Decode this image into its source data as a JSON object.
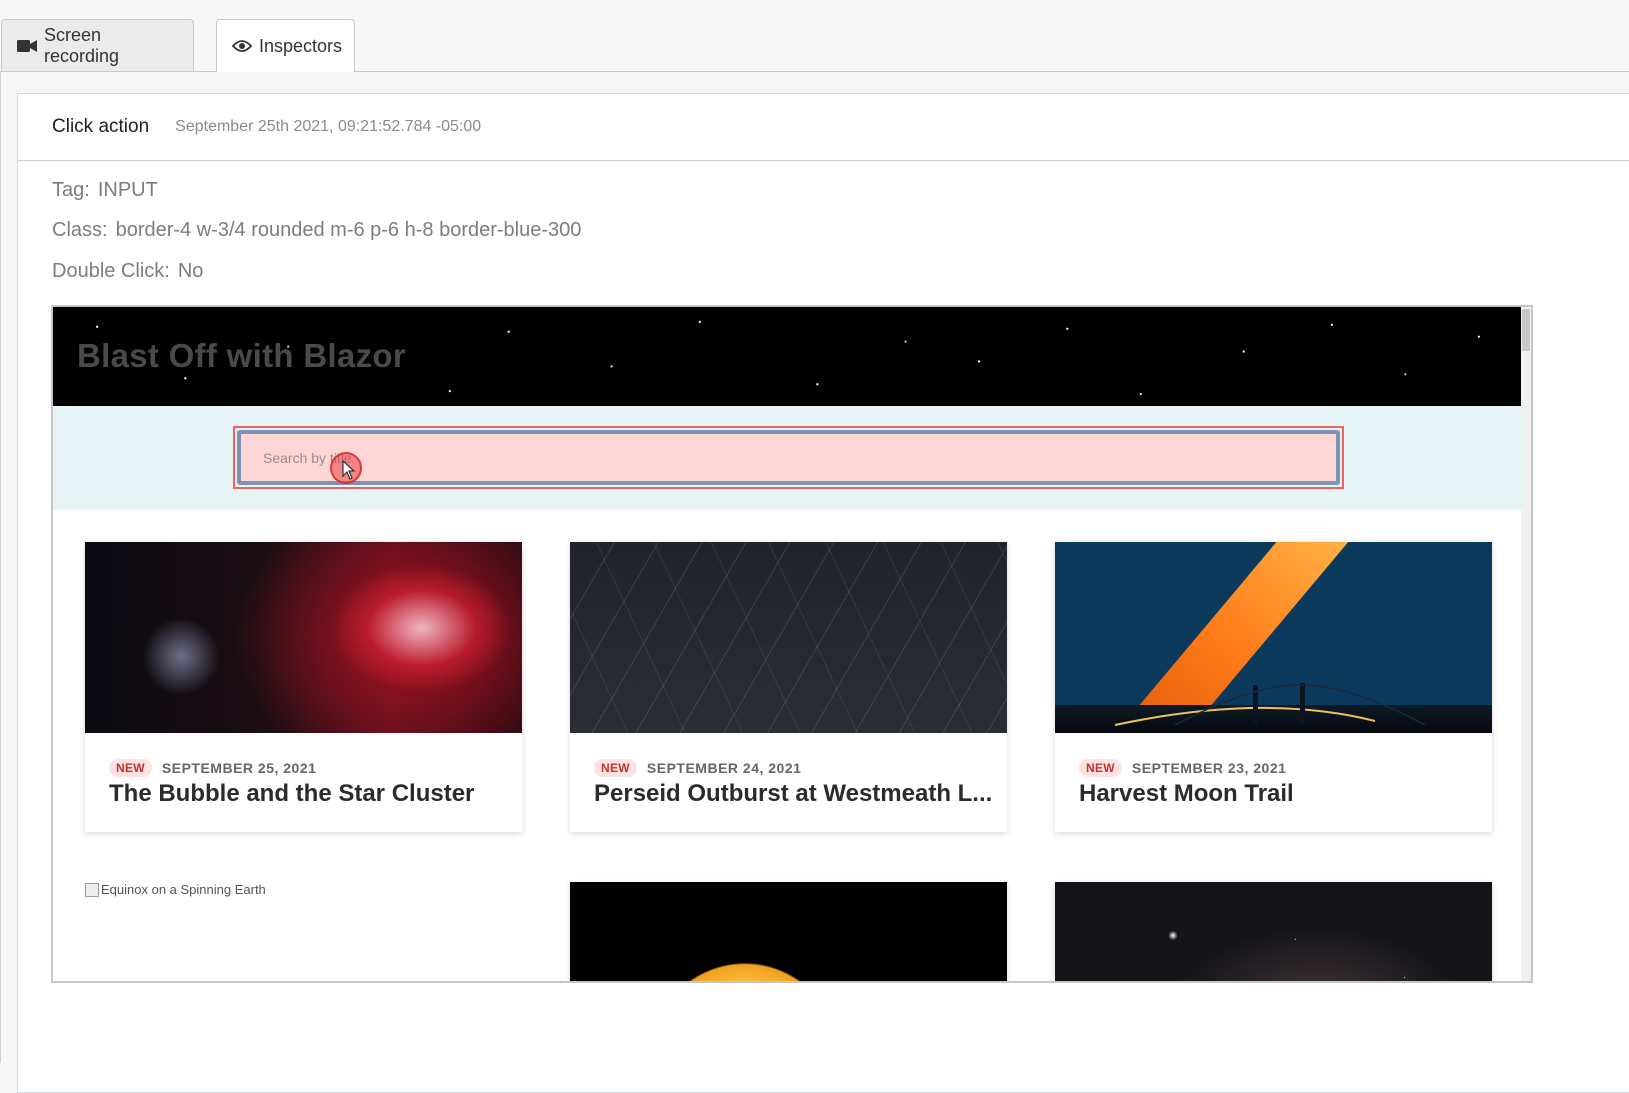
{
  "tabs": [
    {
      "label": "Screen recording",
      "icon": "video-camera-icon",
      "active": false
    },
    {
      "label": "Inspectors",
      "icon": "eye-icon",
      "active": true
    }
  ],
  "event": {
    "action": "Click action",
    "timestamp": "September 25th 2021, 09:21:52.784 -05:00"
  },
  "properties": [
    {
      "label": "Tag:",
      "value": "INPUT"
    },
    {
      "label": "Class:",
      "value": "border-4 w-3/4 rounded m-6 p-6 h-8 border-blue-300"
    },
    {
      "label": "Double Click:",
      "value": "No"
    }
  ],
  "screenshot": {
    "hero_title": "Blast Off with Blazor",
    "search_placeholder": "Search by title",
    "cards": [
      {
        "badge": "NEW",
        "date": "SEPTEMBER 25, 2021",
        "title": "The Bubble and the Star Cluster",
        "image": "nebula"
      },
      {
        "badge": "NEW",
        "date": "SEPTEMBER 24, 2021",
        "title": "Perseid Outburst at Westmeath L...",
        "image": "meteor-shower"
      },
      {
        "badge": "NEW",
        "date": "SEPTEMBER 23, 2021",
        "title": "Harvest Moon Trail",
        "image": "moon-trail-bridge"
      },
      {
        "alt_text": "Equinox on a Spinning Earth",
        "image": "broken-image"
      },
      {
        "image": "sun"
      },
      {
        "image": "starfield"
      }
    ]
  },
  "colors": {
    "highlight_border": "#f06161",
    "search_fill": "#ffd6d6",
    "search_border": "#7c93b2",
    "badge_text": "#c53030",
    "badge_bg": "#fde2e2",
    "search_band": "#e6f4f5"
  }
}
